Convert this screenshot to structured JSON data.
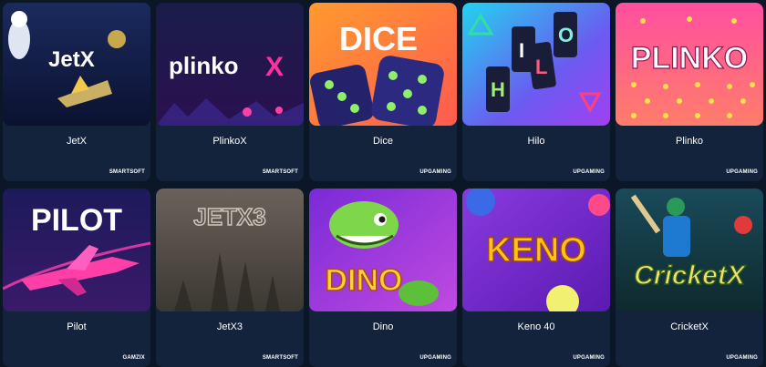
{
  "games": [
    {
      "title": "JetX",
      "provider": "SMARTSOFT",
      "art": "jetx",
      "logo": "JetX"
    },
    {
      "title": "PlinkoX",
      "provider": "SMARTSOFT",
      "art": "plinkox",
      "logo": "plinko"
    },
    {
      "title": "Dice",
      "provider": "UPGAMING",
      "art": "dice",
      "logo": "DICE"
    },
    {
      "title": "Hilo",
      "provider": "UPGAMING",
      "art": "hilo",
      "logo": "HILO"
    },
    {
      "title": "Plinko",
      "provider": "UPGAMING",
      "art": "plinko",
      "logo": "PLINKO"
    },
    {
      "title": "Pilot",
      "provider": "GAMZIX",
      "art": "pilot",
      "logo": "PILOT"
    },
    {
      "title": "JetX3",
      "provider": "SMARTSOFT",
      "art": "jetx3",
      "logo": "JETX3"
    },
    {
      "title": "Dino",
      "provider": "UPGAMING",
      "art": "dino",
      "logo": "DINO"
    },
    {
      "title": "Keno 40",
      "provider": "UPGAMING",
      "art": "keno",
      "logo": "KENO"
    },
    {
      "title": "CricketX",
      "provider": "UPGAMING",
      "art": "cricketx",
      "logo": "CricketX"
    }
  ]
}
